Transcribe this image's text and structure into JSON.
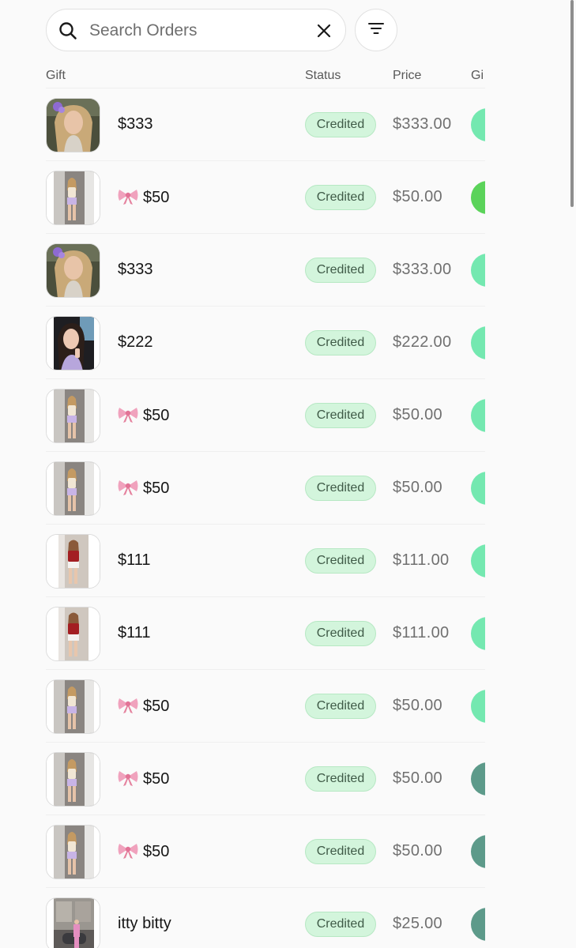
{
  "search": {
    "placeholder": "Search Orders",
    "value": ""
  },
  "icons": {
    "search": "search-icon",
    "clear": "close-icon",
    "filter": "filter-icon",
    "bow": "bow-emoji"
  },
  "table": {
    "headers": {
      "gift": "Gift",
      "status": "Status",
      "price": "Price",
      "gifter": "Gi"
    },
    "rows": [
      {
        "thumb": "blonde-selfie",
        "name": "$333",
        "bow": false,
        "status": "Credited",
        "price": "$333.00",
        "avatar_color": "#74e8b0"
      },
      {
        "thumb": "mirror-outfit",
        "name": "$50",
        "bow": true,
        "status": "Credited",
        "price": "$50.00",
        "avatar_color": "#5bd35a"
      },
      {
        "thumb": "blonde-selfie",
        "name": "$333",
        "bow": false,
        "status": "Credited",
        "price": "$333.00",
        "avatar_color": "#74e8b0"
      },
      {
        "thumb": "car-selfie",
        "name": "$222",
        "bow": false,
        "status": "Credited",
        "price": "$222.00",
        "avatar_color": "#74e8b0"
      },
      {
        "thumb": "mirror-outfit",
        "name": "$50",
        "bow": true,
        "status": "Credited",
        "price": "$50.00",
        "avatar_color": "#74e8b0"
      },
      {
        "thumb": "mirror-outfit",
        "name": "$50",
        "bow": true,
        "status": "Credited",
        "price": "$50.00",
        "avatar_color": "#74e8b0"
      },
      {
        "thumb": "red-top",
        "name": "$111",
        "bow": false,
        "status": "Credited",
        "price": "$111.00",
        "avatar_color": "#74e8b0"
      },
      {
        "thumb": "red-top",
        "name": "$111",
        "bow": false,
        "status": "Credited",
        "price": "$111.00",
        "avatar_color": "#74e8b0"
      },
      {
        "thumb": "mirror-outfit",
        "name": "$50",
        "bow": true,
        "status": "Credited",
        "price": "$50.00",
        "avatar_color": "#74e8b0"
      },
      {
        "thumb": "mirror-outfit",
        "name": "$50",
        "bow": true,
        "status": "Credited",
        "price": "$50.00",
        "avatar_color": "#5d9a8a"
      },
      {
        "thumb": "mirror-outfit",
        "name": "$50",
        "bow": true,
        "status": "Credited",
        "price": "$50.00",
        "avatar_color": "#5d9a8a"
      },
      {
        "thumb": "street-pink",
        "name": "itty bitty",
        "bow": false,
        "status": "Credited",
        "price": "$25.00",
        "avatar_color": "#5d9a8a"
      }
    ]
  },
  "colors": {
    "badge_bg": "#d3f5dc",
    "badge_text": "#3f5a47",
    "avatar_mint": "#74e8b0",
    "avatar_green": "#5bd35a",
    "avatar_teal": "#5d9a8a"
  }
}
